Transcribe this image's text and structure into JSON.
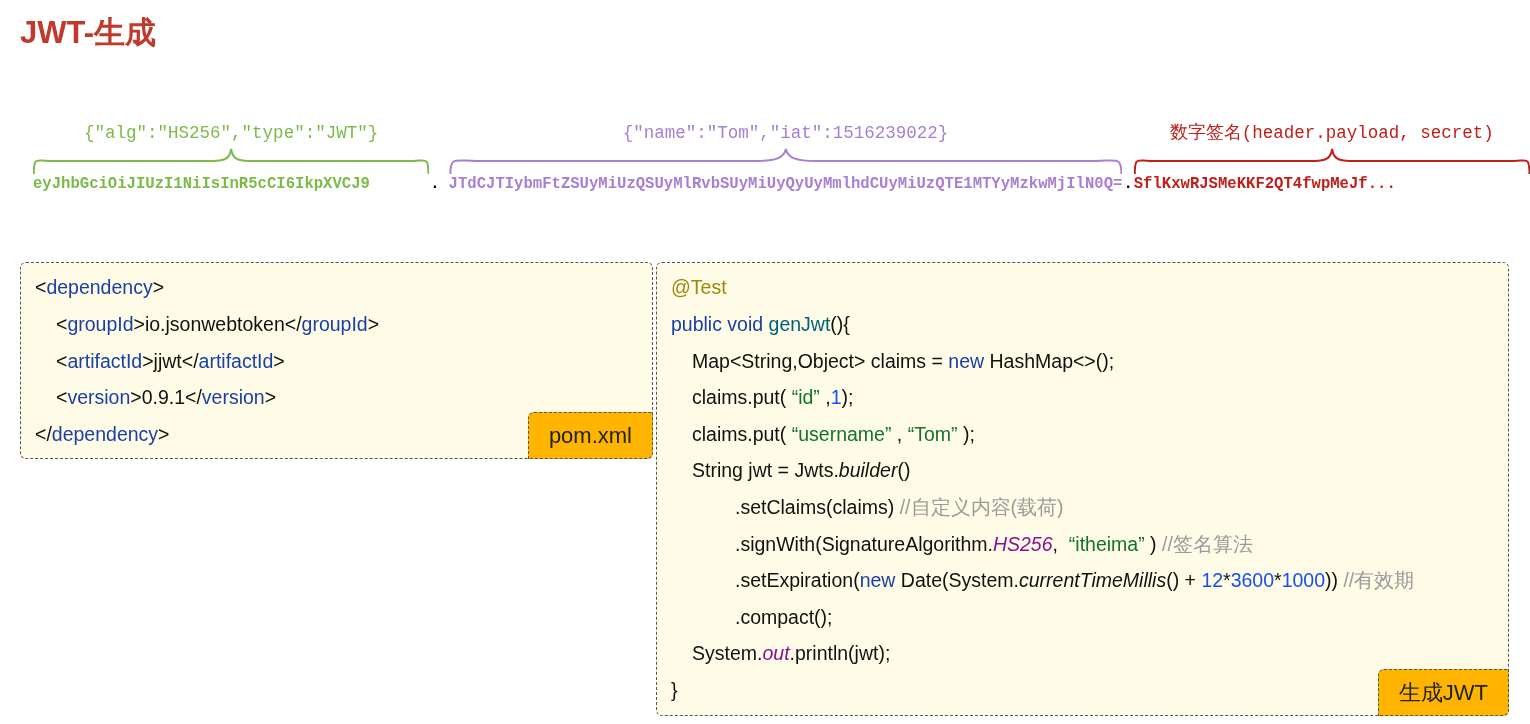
{
  "title": "JWT-生成",
  "token_parts": [
    {
      "label": "{\"alg\":\"HS256\",\"type\":\"JWT\"}",
      "text": "eyJhbGciOiJIUzI1NiIsInR5cCI6IkpXVCJ9",
      "color": "#7cba4a"
    },
    {
      "label": "{\"name\":\"Tom\",\"iat\":1516239022}",
      "text": "JTdCJTIybmFtZSUyMiUzQSUyMlRvbSUyMiUyQyUyMmlhdCUyMiUzQTE1MTYyMzkwMjIlN0Q=",
      "color": "#a77fd4"
    },
    {
      "label": "数字签名(header.payload, secret)",
      "text": "SflKxwRJSMeKKF2QT4fwpMeJf...",
      "color": "#c0201a"
    }
  ],
  "separators": [
    ".",
    "."
  ],
  "xml_box": {
    "caption": "pom.xml",
    "lines": [
      {
        "tokens": [
          {
            "kind": "plain",
            "text": "<"
          },
          {
            "kind": "tag",
            "text": "dependency"
          },
          {
            "kind": "plain",
            "text": ">"
          }
        ],
        "children": [
          {
            "tokens": [
              {
                "kind": "plain",
                "text": "<"
              },
              {
                "kind": "tag",
                "text": "groupId"
              },
              {
                "kind": "plain",
                "text": ">io.jsonwebtoken</"
              },
              {
                "kind": "tag",
                "text": "groupId"
              },
              {
                "kind": "plain",
                "text": ">"
              }
            ]
          },
          {
            "tokens": [
              {
                "kind": "plain",
                "text": "<"
              },
              {
                "kind": "tag",
                "text": "artifactId"
              },
              {
                "kind": "plain",
                "text": ">jjwt</"
              },
              {
                "kind": "tag",
                "text": "artifactId"
              },
              {
                "kind": "plain",
                "text": ">"
              }
            ]
          },
          {
            "tokens": [
              {
                "kind": "plain",
                "text": "<"
              },
              {
                "kind": "tag",
                "text": "version"
              },
              {
                "kind": "plain",
                "text": ">0.9.1</"
              },
              {
                "kind": "tag",
                "text": "version"
              },
              {
                "kind": "plain",
                "text": ">"
              }
            ]
          }
        ]
      },
      {
        "tokens": [
          {
            "kind": "plain",
            "text": "</"
          },
          {
            "kind": "tag",
            "text": "dependency"
          },
          {
            "kind": "plain",
            "text": ">"
          }
        ]
      }
    ]
  },
  "java_box": {
    "caption": "生成JWT",
    "lines": [
      {
        "tokens": [
          {
            "kind": "annotation",
            "text": "@Test"
          }
        ]
      },
      {
        "tokens": [
          {
            "kind": "keyword",
            "text": "public void "
          },
          {
            "kind": "method",
            "text": "genJwt"
          },
          {
            "kind": "plain",
            "text": "(){"
          }
        ],
        "children": [
          {
            "tokens": [
              {
                "kind": "plain",
                "text": "Map<String,Object> claims = "
              },
              {
                "kind": "keyword",
                "text": "new"
              },
              {
                "kind": "plain",
                "text": " HashMap<>();"
              }
            ]
          },
          {
            "tokens": [
              {
                "kind": "plain",
                "text": "claims.put( "
              },
              {
                "kind": "string",
                "text": "“id”"
              },
              {
                "kind": "plain",
                "text": " ,"
              },
              {
                "kind": "number",
                "text": "1"
              },
              {
                "kind": "plain",
                "text": ");"
              }
            ]
          },
          {
            "tokens": [
              {
                "kind": "plain",
                "text": "claims.put( "
              },
              {
                "kind": "string",
                "text": "“username”"
              },
              {
                "kind": "plain",
                "text": " , "
              },
              {
                "kind": "string",
                "text": "“Tom”"
              },
              {
                "kind": "plain",
                "text": " );"
              }
            ]
          },
          {
            "tokens": [
              {
                "kind": "plain",
                "text": "String jwt = Jwts."
              },
              {
                "kind": "static",
                "text": "builder"
              },
              {
                "kind": "plain",
                "text": "()"
              }
            ],
            "children": [
              {
                "tokens": [
                  {
                    "kind": "plain",
                    "text": ".setClaims(claims) "
                  },
                  {
                    "kind": "comment",
                    "text": "//自定义内容(载荷)"
                  }
                ]
              },
              {
                "tokens": [
                  {
                    "kind": "plain",
                    "text": ".signWith(SignatureAlgorithm."
                  },
                  {
                    "kind": "field",
                    "text": "HS256"
                  },
                  {
                    "kind": "plain",
                    "text": ",  "
                  },
                  {
                    "kind": "string",
                    "text": "“itheima”"
                  },
                  {
                    "kind": "plain",
                    "text": " ) "
                  },
                  {
                    "kind": "comment",
                    "text": "//签名算法"
                  }
                ]
              },
              {
                "tokens": [
                  {
                    "kind": "plain",
                    "text": ".setExpiration("
                  },
                  {
                    "kind": "keyword",
                    "text": "new"
                  },
                  {
                    "kind": "plain",
                    "text": " Date(System."
                  },
                  {
                    "kind": "static",
                    "text": "currentTimeMillis"
                  },
                  {
                    "kind": "plain",
                    "text": "() + "
                  },
                  {
                    "kind": "number",
                    "text": "12"
                  },
                  {
                    "kind": "plain",
                    "text": "*"
                  },
                  {
                    "kind": "number",
                    "text": "3600"
                  },
                  {
                    "kind": "plain",
                    "text": "*"
                  },
                  {
                    "kind": "number",
                    "text": "1000"
                  },
                  {
                    "kind": "plain",
                    "text": ")) "
                  },
                  {
                    "kind": "comment",
                    "text": "//有效期"
                  }
                ]
              },
              {
                "tokens": [
                  {
                    "kind": "plain",
                    "text": ".compact();"
                  }
                ]
              }
            ]
          },
          {
            "tokens": [
              {
                "kind": "plain",
                "text": "System."
              },
              {
                "kind": "field",
                "text": "out"
              },
              {
                "kind": "plain",
                "text": ".println(jwt);"
              }
            ]
          }
        ]
      },
      {
        "tokens": [
          {
            "kind": "plain",
            "text": "}"
          }
        ]
      }
    ]
  }
}
